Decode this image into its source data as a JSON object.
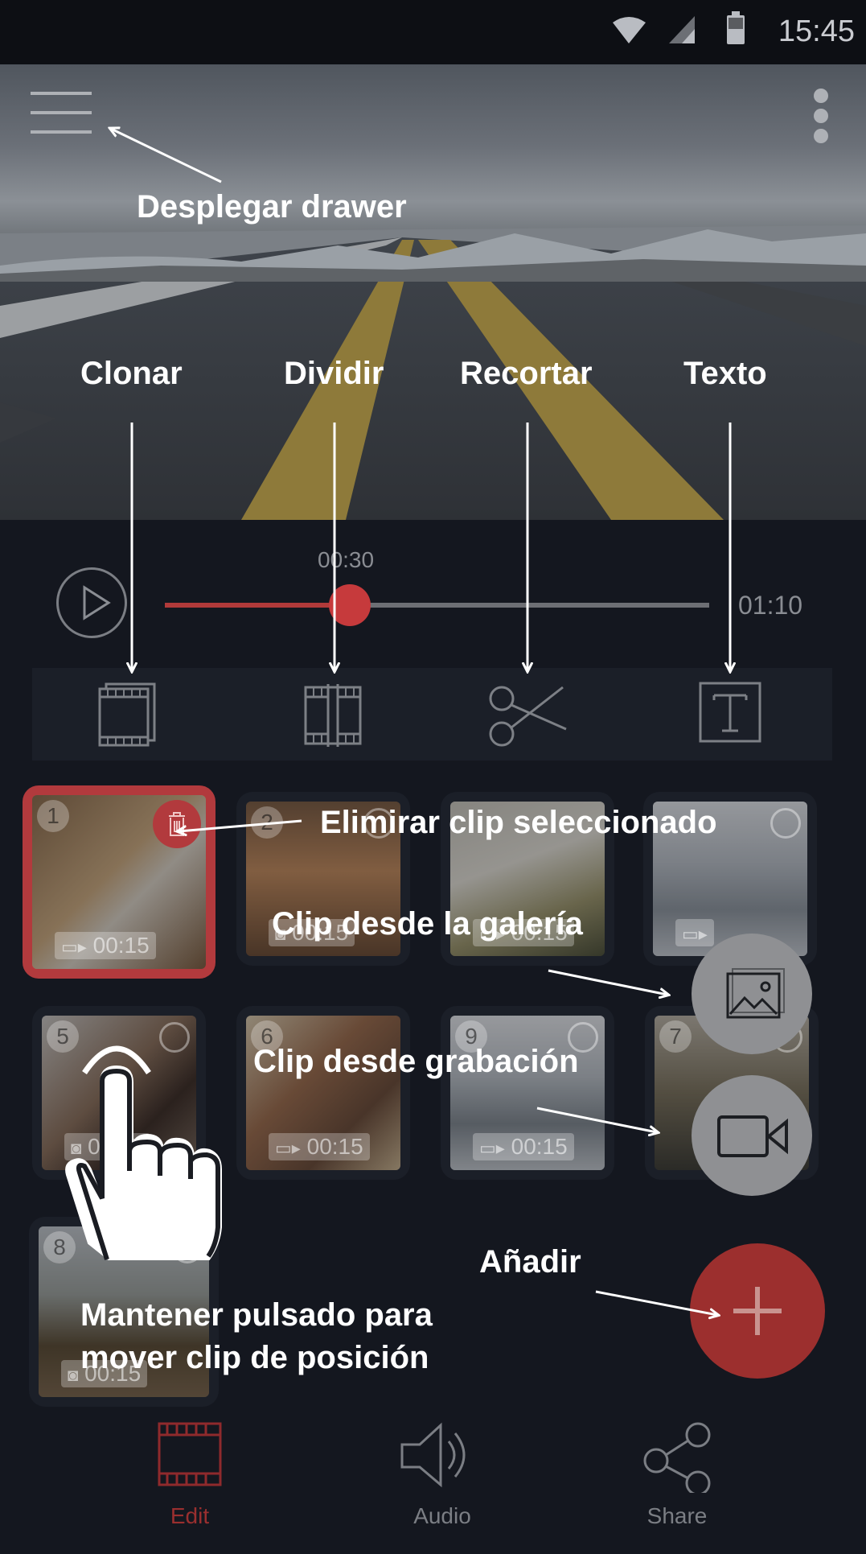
{
  "status_bar": {
    "time": "15:45"
  },
  "player": {
    "current_time": "00:30",
    "total_time": "01:10",
    "progress": 0.34
  },
  "annotations": {
    "drawer": "Desplegar drawer",
    "clone": "Clonar",
    "split": "Dividir",
    "trim": "Recortar",
    "text": "Texto",
    "delete_clip": "Elimirar clip seleccionado",
    "clip_gallery": "Clip desde la galería",
    "clip_record": "Clip desde grabación",
    "add": "Añadir",
    "hold_line1": "Mantener pulsado para",
    "hold_line2": "mover clip de posición"
  },
  "clips": [
    {
      "number": "1",
      "duration": "00:15"
    },
    {
      "number": "2",
      "duration": "00:15"
    },
    {
      "number": "3",
      "duration": "00:15"
    },
    {
      "number": "4",
      "duration": ""
    },
    {
      "number": "5",
      "duration": "00:15"
    },
    {
      "number": "6",
      "duration": "00:15"
    },
    {
      "number": "9",
      "duration": "00:15"
    },
    {
      "number": "7",
      "duration": ""
    },
    {
      "number": "8",
      "duration": "00:15"
    }
  ],
  "bottom_nav": [
    {
      "label": "Edit",
      "active": true
    },
    {
      "label": "Audio",
      "active": false
    },
    {
      "label": "Share",
      "active": false
    }
  ],
  "colors": {
    "accent": "#c63a3c",
    "background": "#14171f",
    "toolbar": "#1b1f28"
  }
}
